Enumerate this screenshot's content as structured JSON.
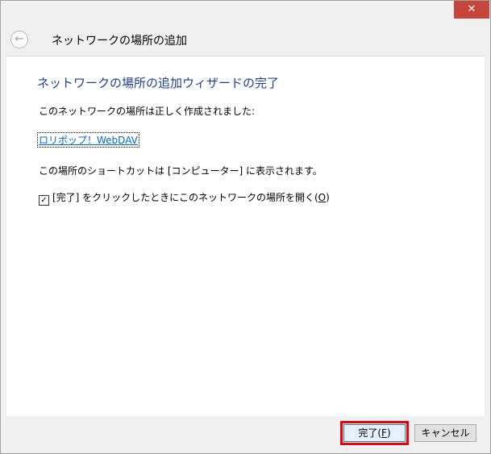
{
  "window": {
    "close_glyph": "✕"
  },
  "header": {
    "back_glyph": "←",
    "title": "ネットワークの場所の追加"
  },
  "content": {
    "wizard_title": "ネットワークの場所の追加ウィザードの完了",
    "created_text": "このネットワークの場所は正しく作成されました:",
    "location_link": "ロリポップ！WebDAV",
    "shortcut_text": "この場所のショートカットは [コンピューター] に表示されます。",
    "checkbox": {
      "checked": true,
      "mark": "✓",
      "label": "[完了] をクリックしたときにこのネットワークの場所を開く(",
      "accel": "O",
      "label_end": ")"
    }
  },
  "footer": {
    "finish": {
      "label": "完了(",
      "accel": "F",
      "label_end": ")"
    },
    "cancel_label": "キャンセル"
  },
  "colors": {
    "title_blue": "#1c3f9a",
    "link_blue": "#0066cc",
    "highlight_red": "#e8000a",
    "close_red": "#c7453a"
  }
}
